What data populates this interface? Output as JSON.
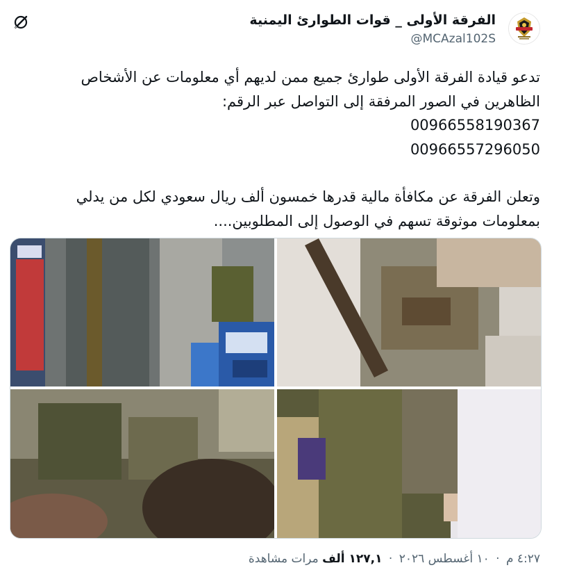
{
  "tweet": {
    "display_name": "الفرقة الأولى _ قوات الطوارئ اليمنية",
    "handle": "@MCAzal102S",
    "text_lines": [
      "تدعو قيادة الفرقة الأولى طوارئ جميع ممن لديهم أي معلومات عن الأشخاص",
      "الظاهرين في الصور المرفقة إلى التواصل عبر الرقم:",
      "00966558190367",
      "00966557296050",
      "وتعلن الفرقة عن مكافأة مالية قدرها خمسون ألف ريال سعودي لكل من يدلي",
      "بمعلومات موثوقة تسهم في الوصول إلى المطلوبين...."
    ],
    "time": "٤:٢٧ م",
    "date": "١٠ أغسطس ٢٠٢٦",
    "separator": "·",
    "views_count": "١٢٧,١ ألف",
    "views_label": "مرات مشاهدة"
  },
  "icons": {
    "avatar": "unit-emblem-avatar",
    "grok": "grok-slash-icon"
  },
  "colors": {
    "text_primary": "#0f1419",
    "text_secondary": "#536471",
    "border": "#cfd9de",
    "background": "#ffffff"
  }
}
